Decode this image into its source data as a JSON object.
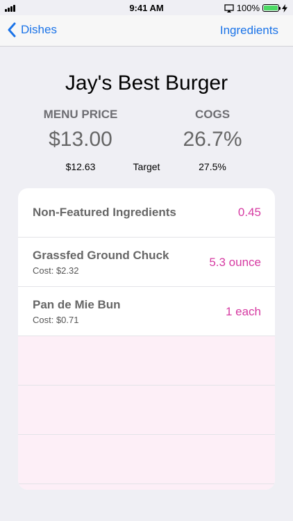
{
  "status_bar": {
    "time": "9:41 AM",
    "battery": "100%",
    "battery_level": 1.0
  },
  "nav": {
    "back_label": "Dishes",
    "right_label": "Ingredients"
  },
  "dish": {
    "title": "Jay's Best Burger",
    "menu_price_label": "MENU PRICE",
    "menu_price": "$13.00",
    "menu_price_target": "$12.63",
    "cogs_label": "COGS",
    "cogs": "26.7%",
    "cogs_target": "27.5%",
    "target_label": "Target"
  },
  "ingredients": {
    "non_featured_label": "Non-Featured Ingredients",
    "non_featured_value": "0.45",
    "items": [
      {
        "name": "Grassfed Ground Chuck",
        "cost": "Cost: $2.32",
        "qty": "5.3 ounce"
      },
      {
        "name": "Pan de Mie Bun",
        "cost": "Cost: $0.71",
        "qty": "1 each"
      }
    ]
  },
  "colors": {
    "accent": "#1a73e8",
    "quantity": "#d63aa2",
    "empty_row": "#fdeff7"
  }
}
